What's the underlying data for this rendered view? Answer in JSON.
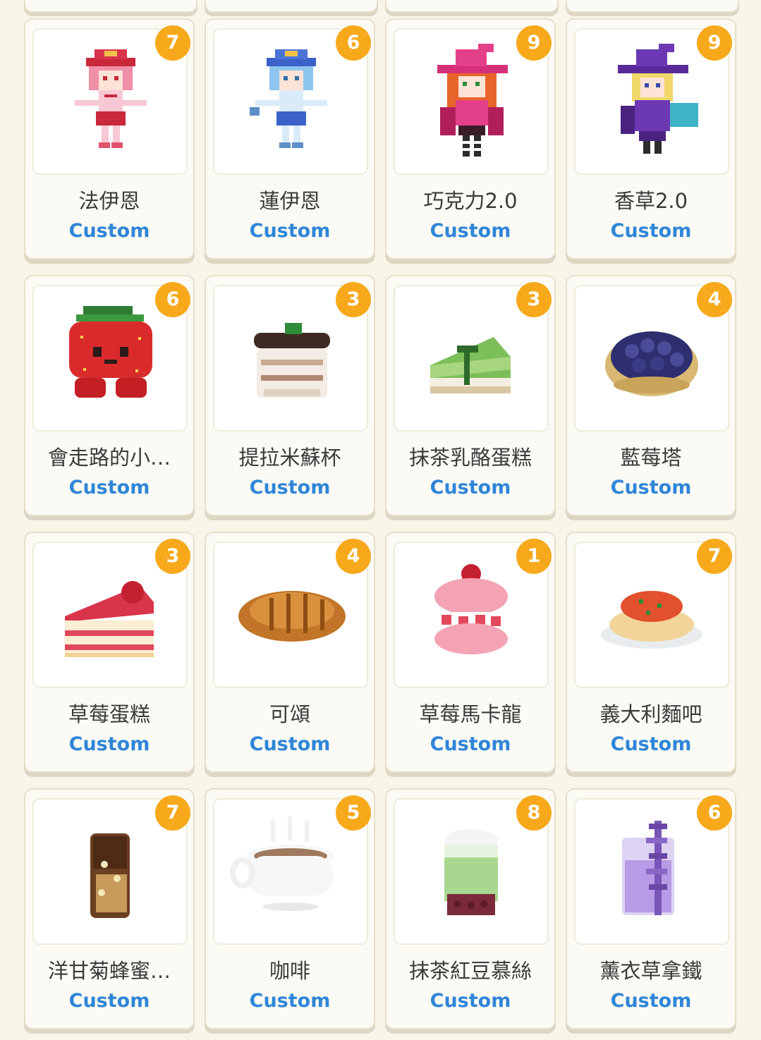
{
  "cards": [
    {
      "name": "法伊恩",
      "tag": "Custom",
      "count": "7",
      "icon": "pixel-girl-red-hat-icon"
    },
    {
      "name": "蓮伊恩",
      "tag": "Custom",
      "count": "6",
      "icon": "pixel-girl-blue-hat-icon"
    },
    {
      "name": "巧克力2.0",
      "tag": "Custom",
      "count": "9",
      "icon": "pixel-witch-pink-icon"
    },
    {
      "name": "香草2.0",
      "tag": "Custom",
      "count": "9",
      "icon": "pixel-witch-purple-icon"
    },
    {
      "name": "會走路的小…",
      "tag": "Custom",
      "count": "6",
      "icon": "strawberry-character-icon"
    },
    {
      "name": "提拉米蘇杯",
      "tag": "Custom",
      "count": "3",
      "icon": "tiramisu-cup-icon"
    },
    {
      "name": "抹茶乳酪蛋糕",
      "tag": "Custom",
      "count": "3",
      "icon": "matcha-cheesecake-icon"
    },
    {
      "name": "藍莓塔",
      "tag": "Custom",
      "count": "4",
      "icon": "blueberry-tart-icon"
    },
    {
      "name": "草莓蛋糕",
      "tag": "Custom",
      "count": "3",
      "icon": "strawberry-cake-icon"
    },
    {
      "name": "可頌",
      "tag": "Custom",
      "count": "4",
      "icon": "croissant-icon"
    },
    {
      "name": "草莓馬卡龍",
      "tag": "Custom",
      "count": "1",
      "icon": "strawberry-macaron-icon"
    },
    {
      "name": "義大利麵吧",
      "tag": "Custom",
      "count": "7",
      "icon": "spaghetti-icon"
    },
    {
      "name": "洋甘菊蜂蜜…",
      "tag": "Custom",
      "count": "7",
      "icon": "chamomile-honey-drink-icon"
    },
    {
      "name": "咖啡",
      "tag": "Custom",
      "count": "5",
      "icon": "coffee-cup-icon"
    },
    {
      "name": "抹茶紅豆慕絲",
      "tag": "Custom",
      "count": "8",
      "icon": "matcha-redbean-mousse-icon"
    },
    {
      "name": "薰衣草拿鐵",
      "tag": "Custom",
      "count": "6",
      "icon": "lavender-latte-icon"
    }
  ],
  "colors": {
    "background": "#f8f5e9",
    "badge": "#f7a91b",
    "tag": "#2f86d8",
    "name": "#3a3a3a"
  }
}
